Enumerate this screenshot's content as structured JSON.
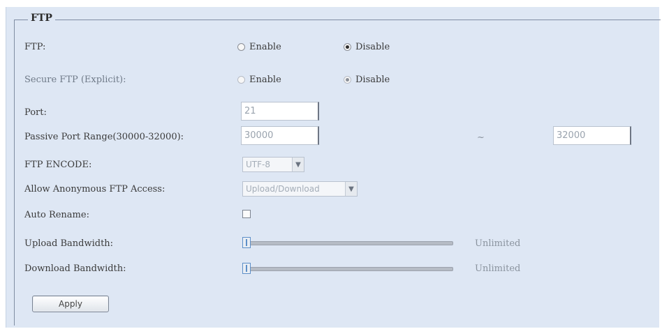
{
  "section": {
    "legend": "FTP"
  },
  "rows": {
    "ftp": {
      "label": "FTP:",
      "options": [
        "Enable",
        "Disable"
      ],
      "selected": "Disable"
    },
    "secure_ftp": {
      "label": "Secure FTP (Explicit):",
      "options": [
        "Enable",
        "Disable"
      ],
      "selected": "Disable",
      "disabled": true
    },
    "port": {
      "label": "Port:",
      "value": "21"
    },
    "passive_port_range": {
      "label": "Passive Port Range(30000-32000):",
      "start": "30000",
      "separator": "~",
      "end": "32000"
    },
    "ftp_encode": {
      "label": "FTP ENCODE:",
      "value": "UTF-8"
    },
    "anonymous_access": {
      "label": "Allow Anonymous FTP Access:",
      "value": "Upload/Download"
    },
    "auto_rename": {
      "label": "Auto Rename:",
      "checked": false
    },
    "upload_bandwidth": {
      "label": "Upload Bandwidth:",
      "level": 0,
      "value_text": "Unlimited"
    },
    "download_bandwidth": {
      "label": "Download Bandwidth:",
      "level": 0,
      "value_text": "Unlimited"
    }
  },
  "actions": {
    "apply": "Apply"
  },
  "icons": {
    "select_arrow": "chevron-down-icon",
    "slider_handle": "slider-thumb-icon"
  },
  "colors": {
    "panel_background": "#dee7f4",
    "text": "#333333",
    "disabled_text": "#9aa3ae",
    "accent": "#5d8fc8"
  }
}
